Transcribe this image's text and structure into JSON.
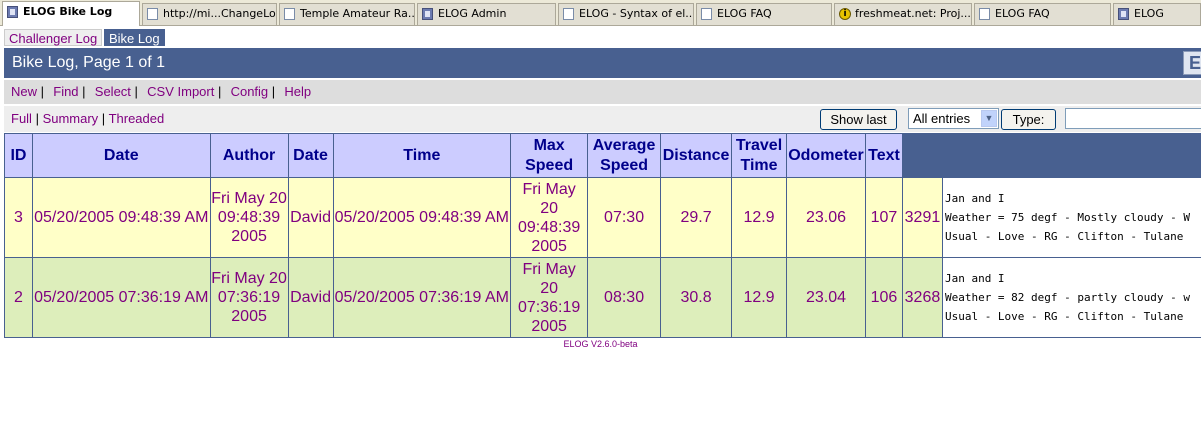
{
  "browser_tabs": [
    {
      "label": "ELOG Bike Log",
      "icon": "elog-icon",
      "active": true
    },
    {
      "label": "http://mi...ChangeLog",
      "icon": "page-icon"
    },
    {
      "label": "Temple Amateur Ra...",
      "icon": "page-icon"
    },
    {
      "label": "ELOG Admin",
      "icon": "elog-icon"
    },
    {
      "label": "ELOG - Syntax of el...",
      "icon": "page-icon"
    },
    {
      "label": "ELOG FAQ",
      "icon": "page-icon"
    },
    {
      "label": "freshmeat.net: Proj...",
      "icon": "freshmeat-icon"
    },
    {
      "label": "ELOG FAQ",
      "icon": "page-icon"
    },
    {
      "label": "ELOG",
      "icon": "elog-icon"
    }
  ],
  "logbooks": {
    "other": "Challenger Log",
    "current": "Bike Log"
  },
  "title": "Bike Log, Page 1 of 1",
  "menu": {
    "new": "New",
    "find": "Find",
    "select": "Select",
    "csv_import": "CSV Import",
    "config": "Config",
    "help": "Help"
  },
  "views": {
    "full": "Full",
    "summary": "Summary",
    "threaded": "Threaded"
  },
  "controls": {
    "show_last": "Show last",
    "filter_value": "All entries",
    "type_button": "Type:",
    "type_value": ""
  },
  "table": {
    "headers": [
      "ID",
      "Date",
      "Author",
      "Date",
      "Time",
      "Max\nSpeed",
      "Average\nSpeed",
      "Distance",
      "Travel\nTime",
      "Odometer",
      "Text"
    ],
    "rows": [
      {
        "id": "3",
        "date": "05/20/2005 09:48:39 AM",
        "author": "Fri May 20\n09:48:39\n2005",
        "date2": "David",
        "time": "05/20/2005 09:48:39 AM",
        "max_speed": "Fri May\n20\n09:48:39\n2005",
        "average_speed": "07:30",
        "distance": "29.7",
        "travel_time": "12.9",
        "odometer": "23.06",
        "text": "107",
        "extra": "3291",
        "body": "Jan and I\nWeather = 75 degf - Mostly cloudy - W\nUsual - Love - RG - Clifton - Tulane"
      },
      {
        "id": "2",
        "date": "05/20/2005 07:36:19 AM",
        "author": "Fri May 20\n07:36:19\n2005",
        "date2": "David",
        "time": "05/20/2005 07:36:19 AM",
        "max_speed": "Fri May\n20\n07:36:19\n2005",
        "average_speed": "08:30",
        "distance": "30.8",
        "travel_time": "12.9",
        "odometer": "23.04",
        "text": "106",
        "extra": "3268",
        "body": "Jan and I\nWeather = 82 degf - partly cloudy - w\nUsual - Love - RG - Clifton - Tulane"
      }
    ]
  },
  "footer": "ELOG V2.6.0-beta",
  "colors": {
    "title_bg": "#486090",
    "header_bg": "#ccccff",
    "row_odd": "#ffffc8",
    "row_even": "#ddeebb",
    "link": "#800080"
  }
}
